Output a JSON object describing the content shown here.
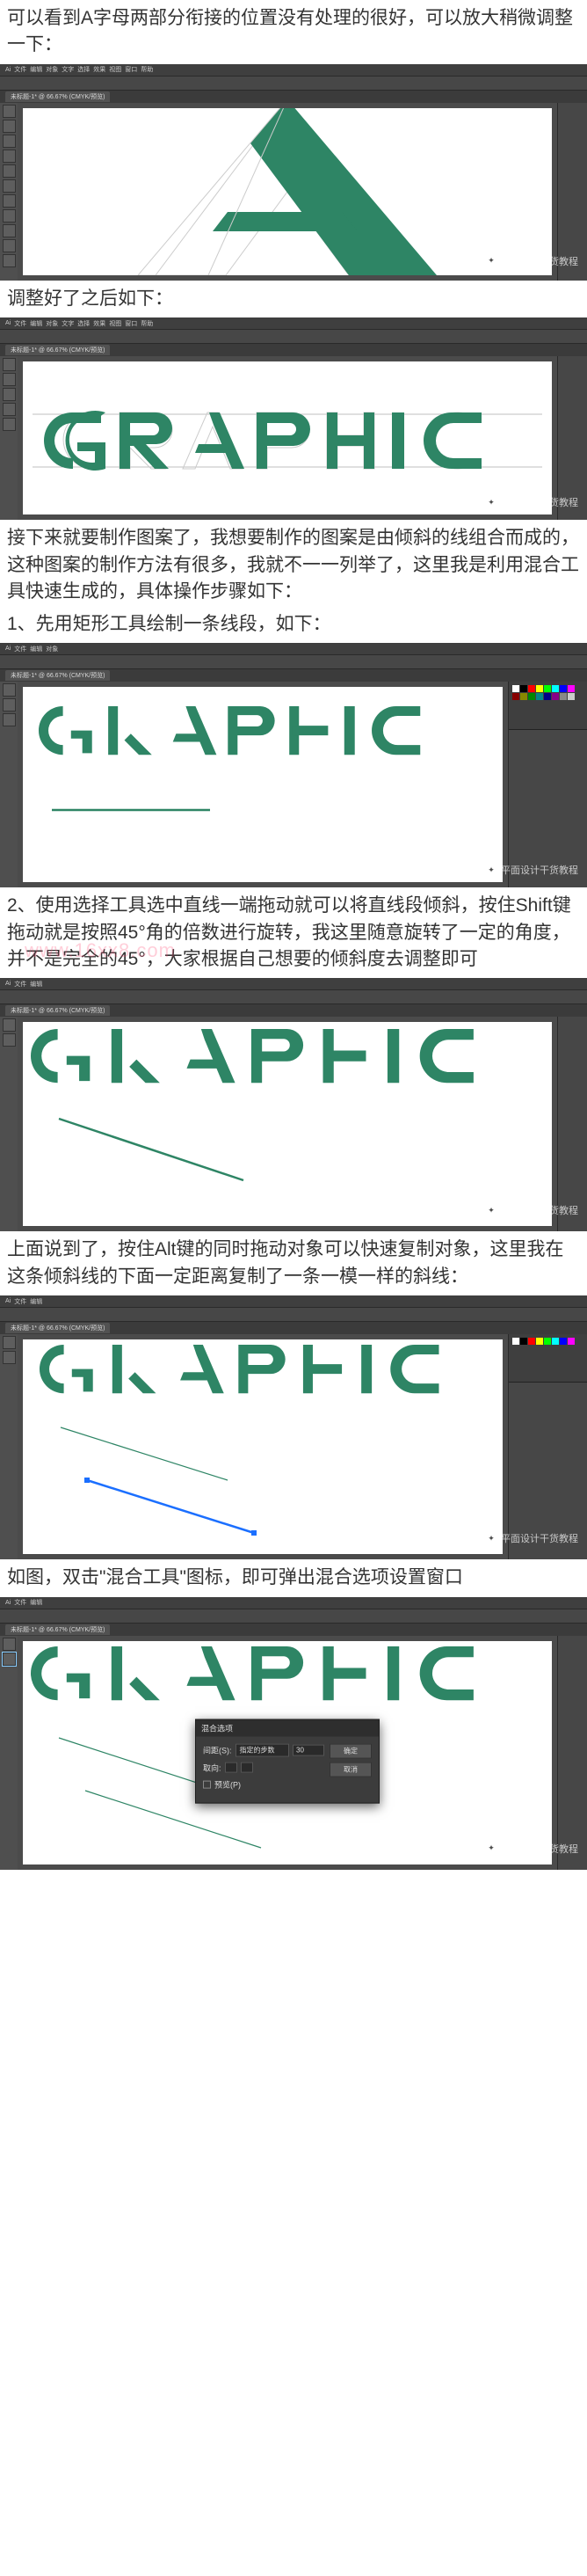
{
  "watermark": "平面设计干货教程",
  "pink_watermark": "www.16xx8.com",
  "menu": {
    "m0": "Ai",
    "m1": "文件",
    "m2": "编辑",
    "m3": "对象",
    "m4": "文字",
    "m5": "选择",
    "m6": "效果",
    "m7": "视图",
    "m8": "窗口",
    "m9": "帮助"
  },
  "tab": "未标题-1* @ 66.67% (CMYK/预览)",
  "para": {
    "p1": "可以看到A字母两部分衔接的位置没有处理的很好，可以放大稍微调整一下：",
    "p2": "调整好了之后如下：",
    "p3": "接下来就要制作图案了，我想要制作的图案是由倾斜的线组合而成的，这种图案的制作方法有很多，我就不一一列举了，这里我是利用混合工具快速生成的，具体操作步骤如下：",
    "p3b": "1、先用矩形工具绘制一条线段，如下：",
    "p4": "2、使用选择工具选中直线一端拖动就可以将直线段倾斜，按住Shift键拖动就是按照45°角的倍数进行旋转，我这里随意旋转了一定的角度，并不是完全的45°，大家根据自己想要的倾斜度去调整即可",
    "p5": "上面说到了，按住Alt键的同时拖动对象可以快速复制对象，这里我在这条倾斜线的下面一定距离复制了一条一模一样的斜线：",
    "p6": "如图，双击\"混合工具\"图标，即可弹出混合选项设置窗口"
  },
  "dialog": {
    "title": "混合选项",
    "spacing_label": "间距(S):",
    "spacing_value": "指定的步数",
    "steps": "30",
    "orient_label": "取向:",
    "preview": "预览(P)",
    "ok": "确定",
    "cancel": "取消"
  }
}
